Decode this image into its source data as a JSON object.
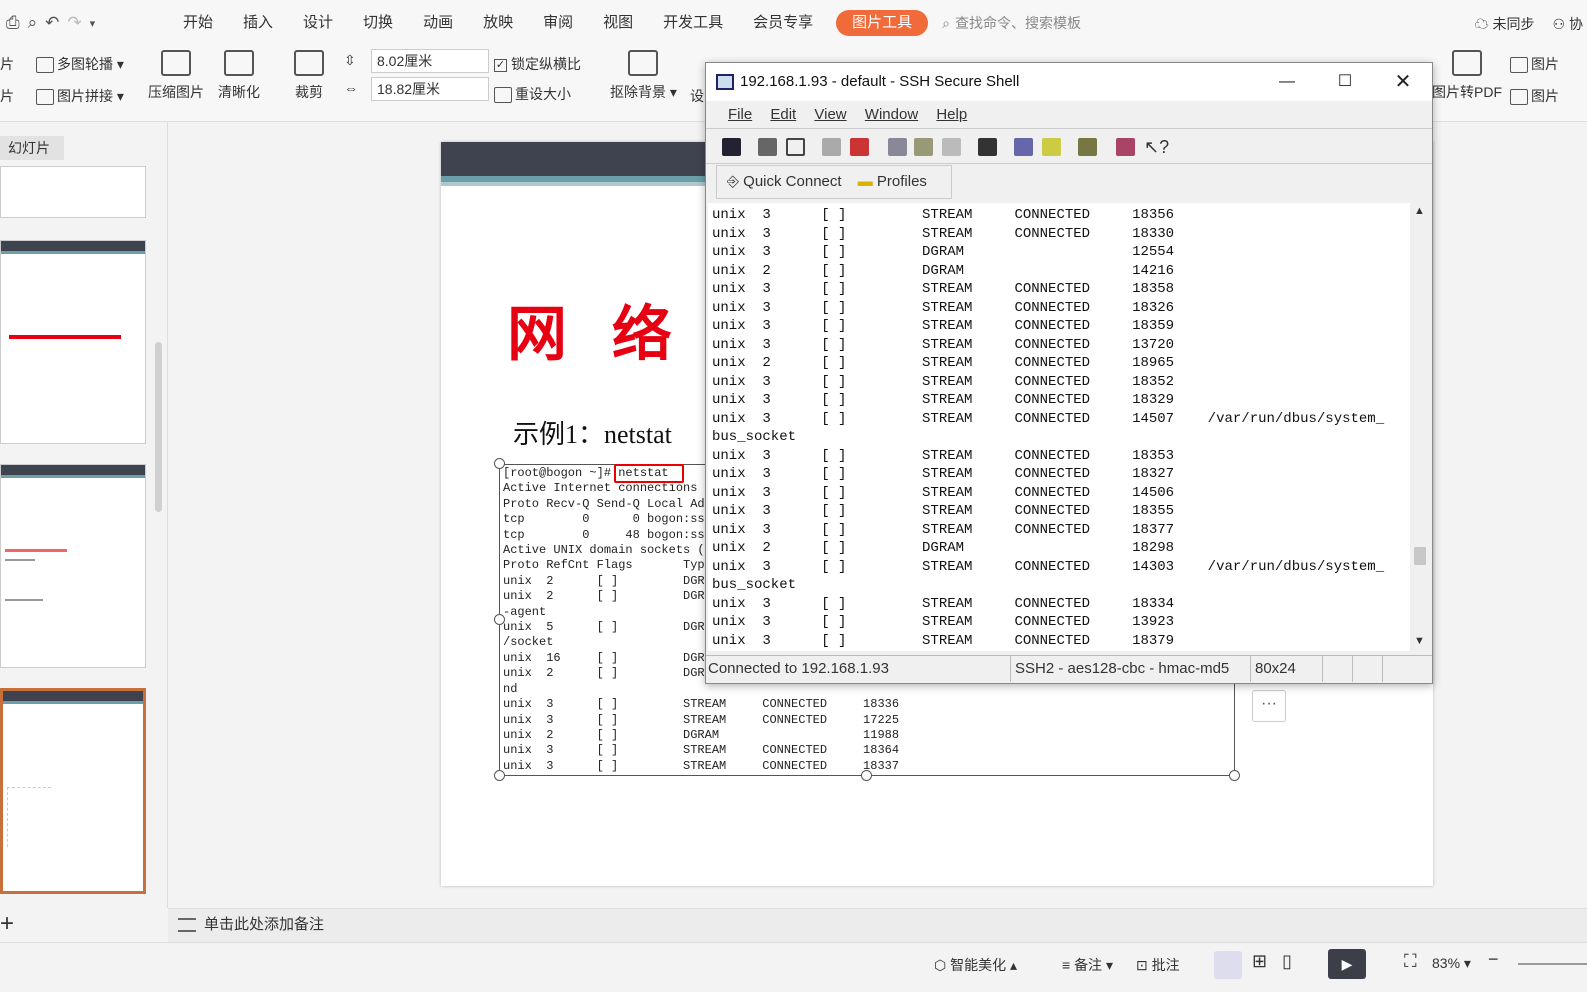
{
  "ribbon": {
    "tabs": [
      "开始",
      "插入",
      "设计",
      "切换",
      "动画",
      "放映",
      "审阅",
      "视图",
      "开发工具",
      "会员专享"
    ],
    "active_tab": "图片工具",
    "search_placeholder": "查找命令、搜索模板",
    "sync": "未同步",
    "collab": "协"
  },
  "toolbar": {
    "partial1": "片",
    "partial2": "片",
    "carousel": "多图轮播",
    "stitch": "图片拼接",
    "compress": "压缩图片",
    "sharpen": "清晰化",
    "crop": "裁剪",
    "width": "8.02厘米",
    "height": "18.82厘米",
    "lock_ratio": "锁定纵横比",
    "reset_size": "重设大小",
    "remove_bg": "抠除背景",
    "partial3": "设",
    "to_pdf": "图片转PDF",
    "pic_right1": "图片",
    "pic_right2": "图片"
  },
  "left_panel": {
    "tab": "幻灯片",
    "add": "+"
  },
  "slide": {
    "title": "网 络 实 ",
    "subtitle": "示例1：netstat ",
    "terminal_lines": [
      "[root@bogon ~]# netstat",
      "Active Internet connections",
      "Proto Recv-Q Send-Q Local Ad",
      "tcp        0      0 bogon:ss",
      "tcp        0     48 bogon:ss",
      "Active UNIX domain sockets (",
      "Proto RefCnt Flags       Typ",
      "unix  2      [ ]         DGR",
      "unix  2      [ ]         DGR",
      "-agent",
      "unix  5      [ ]         DGR",
      "/socket",
      "unix  16     [ ]         DGR",
      "unix  2      [ ]         DGR",
      "nd",
      "unix  3      [ ]         STREAM     CONNECTED     18336",
      "unix  3      [ ]         STREAM     CONNECTED     17225",
      "unix  2      [ ]         DGRAM                    11988",
      "unix  3      [ ]         STREAM     CONNECTED     18364",
      "unix  3      [ ]         STREAM     CONNECTED     18337"
    ],
    "more": "···"
  },
  "notes": {
    "placeholder": "单击此处添加备注"
  },
  "statusbar": {
    "beautify": "智能美化",
    "notes": "备注",
    "comments": "批注",
    "zoom": "83%"
  },
  "ssh": {
    "title": "192.168.1.93 - default - SSH Secure Shell",
    "menu": [
      "File",
      "Edit",
      "View",
      "Window",
      "Help"
    ],
    "quick_connect": "Quick Connect",
    "profiles": "Profiles",
    "lines": [
      "unix  3      [ ]         STREAM     CONNECTED     18356",
      "unix  3      [ ]         STREAM     CONNECTED     18330",
      "unix  3      [ ]         DGRAM                    12554",
      "unix  2      [ ]         DGRAM                    14216",
      "unix  3      [ ]         STREAM     CONNECTED     18358",
      "unix  3      [ ]         STREAM     CONNECTED     18326",
      "unix  3      [ ]         STREAM     CONNECTED     18359",
      "unix  3      [ ]         STREAM     CONNECTED     13720",
      "unix  2      [ ]         STREAM     CONNECTED     18965",
      "unix  3      [ ]         STREAM     CONNECTED     18352",
      "unix  3      [ ]         STREAM     CONNECTED     18329",
      "unix  3      [ ]         STREAM     CONNECTED     14507    /var/run/dbus/system_",
      "bus_socket",
      "unix  3      [ ]         STREAM     CONNECTED     18353",
      "unix  3      [ ]         STREAM     CONNECTED     18327",
      "unix  3      [ ]         STREAM     CONNECTED     14506",
      "unix  3      [ ]         STREAM     CONNECTED     18355",
      "unix  3      [ ]         STREAM     CONNECTED     18377",
      "unix  2      [ ]         DGRAM                    18298",
      "unix  3      [ ]         STREAM     CONNECTED     14303    /var/run/dbus/system_",
      "bus_socket",
      "unix  3      [ ]         STREAM     CONNECTED     18334",
      "unix  3      [ ]         STREAM     CONNECTED     13923",
      "unix  3      [ ]         STREAM     CONNECTED     18379"
    ],
    "status_connected": "Connected to 192.168.1.93",
    "status_cipher": "SSH2 - aes128-cbc - hmac-md5",
    "status_size": "80x24"
  }
}
